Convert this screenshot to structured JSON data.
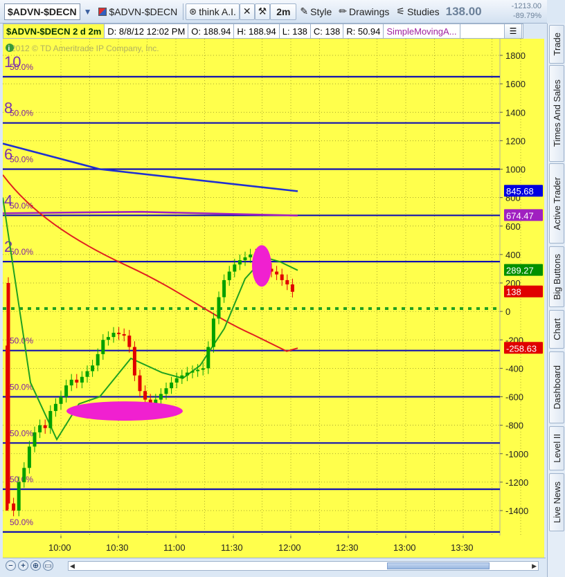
{
  "toolbar": {
    "symbol": "$ADVN-$DECN",
    "linked_symbol": "$ADVN-$DECN",
    "think_ai": "think A.I.",
    "timeframe": "2m",
    "style": "Style",
    "drawings": "Drawings",
    "studies": "Studies",
    "last_price": "138.00",
    "net_change": "-1213.00",
    "pct_change": "-89.79%"
  },
  "header": {
    "title": "$ADVN-$DECN 2 d 2m",
    "date": "D: 8/8/12 12:02 PM",
    "open": "O: 188.94",
    "high": "H: 188.94",
    "low": "L: 138",
    "close": "C: 138",
    "range": "R: 50.94",
    "study": "SimpleMovingA..."
  },
  "right_tabs": [
    "Trade",
    "Times And Sales",
    "Active Trader",
    "Big Buttons",
    "Chart",
    "Dashboard",
    "Level II",
    "Live News"
  ],
  "watermark": "2012 © TD Ameritrade IP Company, Inc.",
  "colors": {
    "background": "#ffff4c",
    "grid": "#9c9c00",
    "level_line": "#1010b0",
    "candle_up": "#00a000",
    "candle_down": "#e00000",
    "sma_fast": "#20a020",
    "sma_slow": "#e02020",
    "sma_blue": "#2030d0",
    "purple": "#a020c0",
    "highlight": "#f020d0",
    "zero_dotted": "#20a020"
  },
  "chart_data": {
    "type": "candlestick",
    "x_ticks": [
      "10:00",
      "10:30",
      "11:00",
      "11:30",
      "12:00",
      "12:30",
      "13:00",
      "13:30"
    ],
    "y_ticks": [
      1800,
      1600,
      1400,
      1200,
      1000,
      800,
      600,
      400,
      200,
      0,
      -200,
      -400,
      -600,
      -800,
      -1000,
      -1200,
      -1400
    ],
    "ylim": [
      -1550,
      1850
    ],
    "level_lines": [
      {
        "value": 1650,
        "label": "10",
        "pct": "50.0%"
      },
      {
        "value": 1325,
        "label": "8",
        "pct": "50.0%"
      },
      {
        "value": 1000,
        "label": "6",
        "pct": "50.0%"
      },
      {
        "value": 675,
        "label": "4",
        "pct": "50.0%"
      },
      {
        "value": 350,
        "label": "2",
        "pct": "50.0%"
      },
      {
        "value": -275,
        "label": "",
        "pct": "50.0%"
      },
      {
        "value": -600,
        "label": "",
        "pct": "50.0%"
      },
      {
        "value": -925,
        "label": "",
        "pct": "50.0%"
      },
      {
        "value": -1250,
        "label": "",
        "pct": "50.0%"
      },
      {
        "value": -1550,
        "label": "",
        "pct": "50.0%"
      }
    ],
    "zero_line": 20,
    "price_labels": [
      {
        "value": 845.68,
        "text": "845.68",
        "color": "#0000e0"
      },
      {
        "value": 674.47,
        "text": "674.47",
        "color": "#a020c0"
      },
      {
        "value": 289.27,
        "text": "289.27",
        "color": "#009000"
      },
      {
        "value": 138,
        "text": "138",
        "color": "#e00000"
      },
      {
        "value": -258.63,
        "text": "-258.63",
        "color": "#e00000"
      }
    ]
  }
}
